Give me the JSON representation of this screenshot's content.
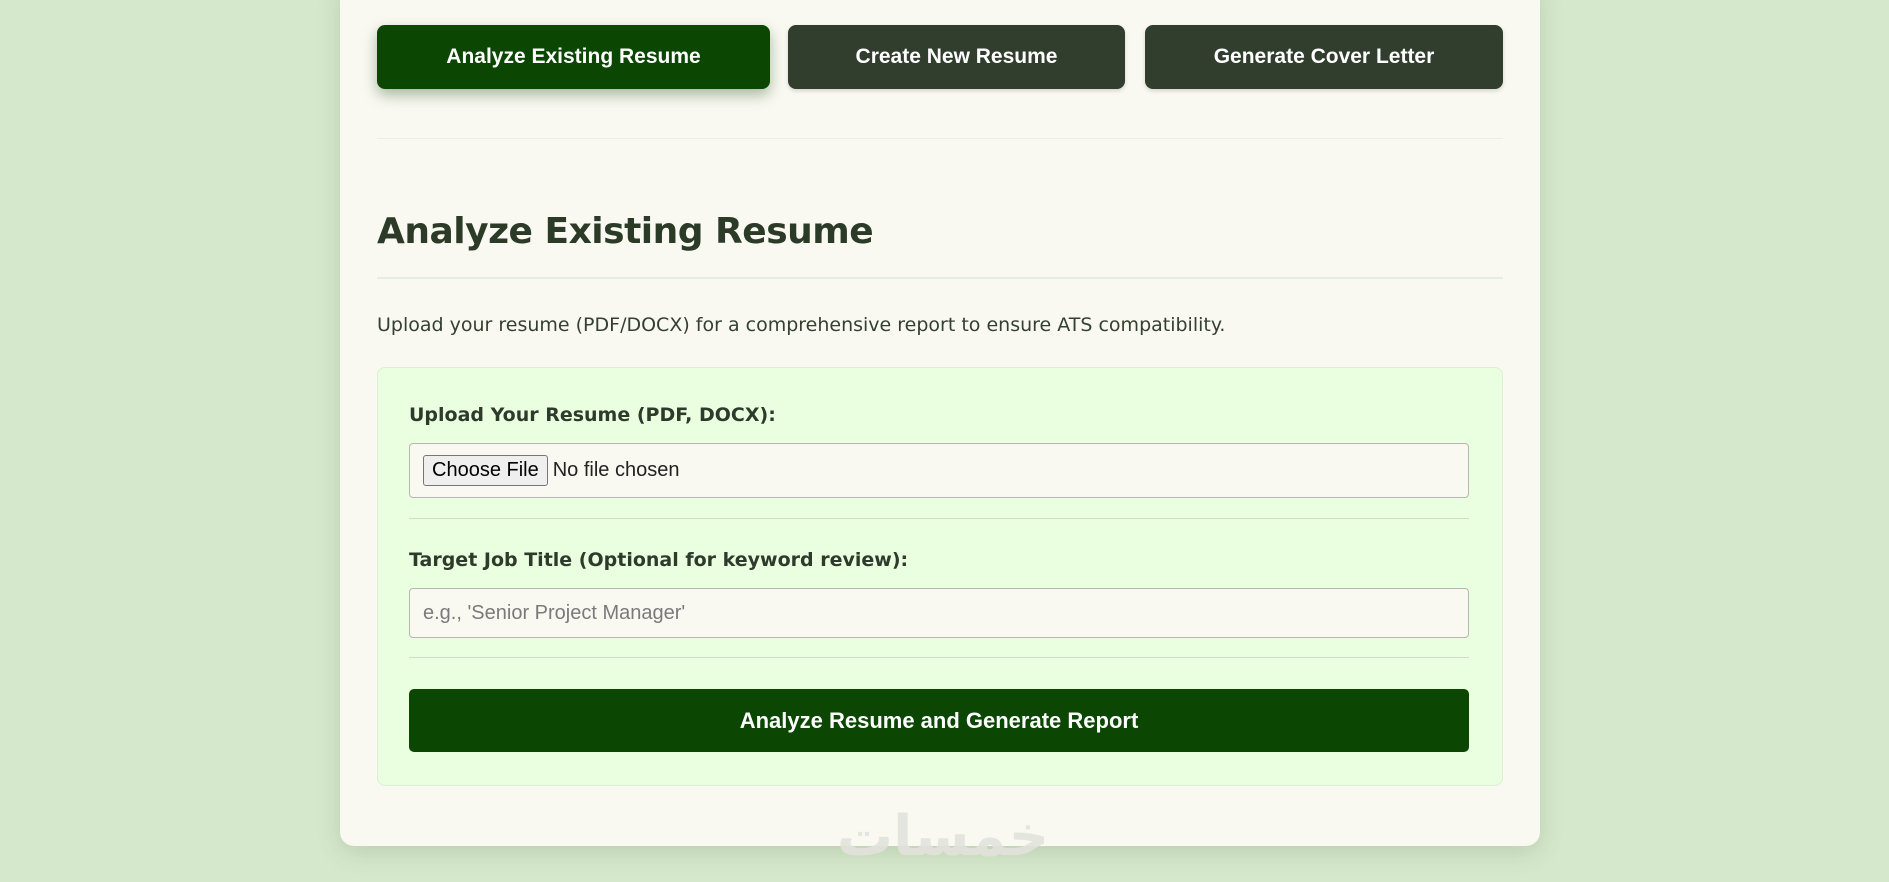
{
  "tabs": [
    {
      "label": "Analyze Existing Resume",
      "active": true
    },
    {
      "label": "Create New Resume",
      "active": false
    },
    {
      "label": "Generate Cover Letter",
      "active": false
    }
  ],
  "section": {
    "title": "Analyze Existing Resume",
    "description": "Upload your resume (PDF/DOCX) for a comprehensive report to ensure ATS compatibility."
  },
  "form": {
    "upload_label": "Upload Your Resume (PDF, DOCX):",
    "choose_file_label": "Choose File",
    "file_status": "No file chosen",
    "job_title_label": "Target Job Title (Optional for keyword review):",
    "job_title_placeholder": "e.g., 'Senior Project Manager'",
    "job_title_value": "",
    "submit_label": "Analyze Resume and Generate Report"
  },
  "watermark": {
    "text": "خمسات"
  },
  "colors": {
    "page_background": "#d6e8cc",
    "card_background": "#f9f9f2",
    "active_tab": "#0b4703",
    "inactive_tab": "#313d2d",
    "form_panel": "#eaffdf",
    "primary_button": "#0b4703"
  }
}
